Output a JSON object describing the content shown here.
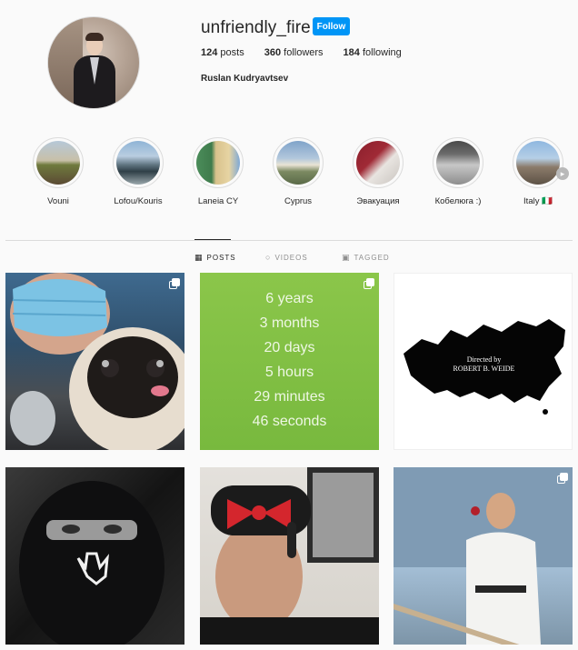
{
  "profile": {
    "username": "unfriendly_fire",
    "follow_label": "Follow",
    "posts_count": "124",
    "posts_label": "posts",
    "followers_count": "360",
    "followers_label": "followers",
    "following_count": "184",
    "following_label": "following",
    "full_name": "Ruslan Kudryavtsev"
  },
  "highlights": [
    {
      "label": "Vouni"
    },
    {
      "label": "Lofou/Kouris"
    },
    {
      "label": "Laneia CY"
    },
    {
      "label": "Cyprus"
    },
    {
      "label": "Эвакуация"
    },
    {
      "label": "Кобелюга :)"
    },
    {
      "label": "Italy 🇮🇹"
    }
  ],
  "tabs": [
    {
      "label": "POSTS",
      "icon": "grid-icon"
    },
    {
      "label": "VIDEOS",
      "icon": "play-icon"
    },
    {
      "label": "TAGGED",
      "icon": "tag-icon"
    }
  ],
  "countdown": [
    "6 years",
    "3 months",
    "20 days",
    "5 hours",
    "29 minutes",
    "46 seconds"
  ],
  "russia_post": {
    "line1": "Directed by",
    "line2": "ROBERT B. WEIDE"
  },
  "colors": {
    "accent": "#0095f6",
    "countdown_bg": "#7dbb42"
  }
}
